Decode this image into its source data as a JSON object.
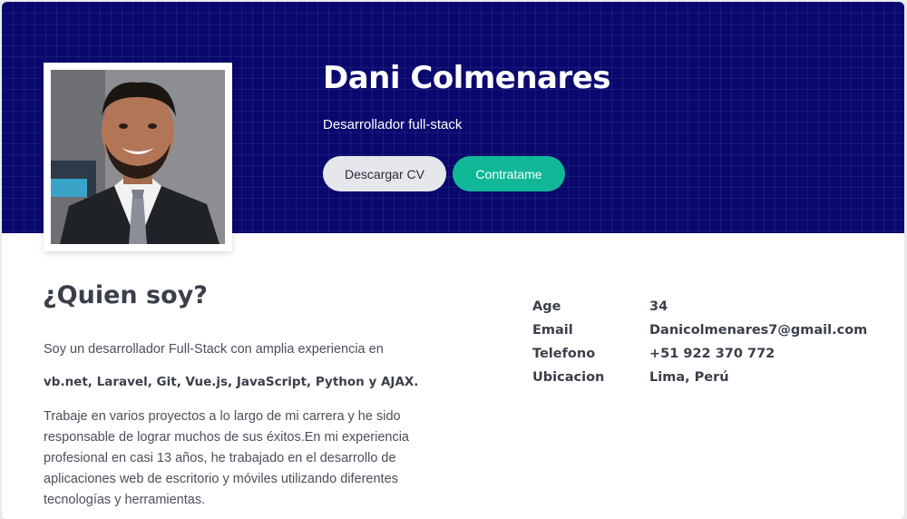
{
  "profile": {
    "name": "Dani Colmenares",
    "role": "Desarrollador full-stack",
    "buttons": {
      "download_cv": "Descargar CV",
      "hire": "Contratame"
    }
  },
  "about": {
    "heading": "¿Quien soy?",
    "intro": "Soy un desarrollador Full-Stack con amplia experiencia en",
    "skills": "vb.net, Laravel, Git, Vue.js, JavaScript, Python y AJAX.",
    "body_lines": [
      "Trabaje en varios proyectos a lo largo de mi carrera y he sido",
      "responsable de lograr muchos de sus éxitos.En mi experiencia",
      "profesional en casi 13 años, he trabajado en el desarrollo de",
      "aplicaciones web de escritorio y móviles utilizando diferentes",
      "tecnologías y herramientas."
    ]
  },
  "info": [
    {
      "label": "Age",
      "value": "34"
    },
    {
      "label": "Email",
      "value": "Danicolmenares7@gmail.com"
    },
    {
      "label": "Telefono",
      "value": "+51 922 370 772"
    },
    {
      "label": "Ubicacion",
      "value": "Lima, Perú"
    }
  ],
  "colors": {
    "hero_bg": "#08086e",
    "accent": "#10b897",
    "secondary_button": "#e5e7eb"
  }
}
